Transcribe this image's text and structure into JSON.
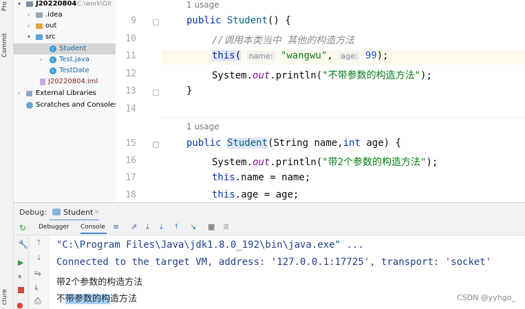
{
  "side_strip": {
    "project_label": "Pro",
    "commit_label": "Commit",
    "structure_label": "cture"
  },
  "tree": {
    "root": {
      "name": "J20220804",
      "path": "C:\\work\\Git"
    },
    "items": [
      {
        "label": ".idea"
      },
      {
        "label": "out"
      },
      {
        "label": "src"
      },
      {
        "label": "Student"
      },
      {
        "label": "Test.java"
      },
      {
        "label": "TestDate"
      },
      {
        "label": "J20220804.iml"
      },
      {
        "label": "External Libraries"
      },
      {
        "label": "Scratches and Consoles"
      }
    ]
  },
  "editor": {
    "line_numbers": [
      "9",
      "10",
      "11",
      "12",
      "13",
      "14",
      "15",
      "16",
      "17",
      "18"
    ],
    "usage1": "1 usage",
    "usage2": "1 usage",
    "l9_kw": "public ",
    "l9_fn": "Student",
    "l9_rest": "() {",
    "l10_comment": "//调用本类当中 其他的构造方法",
    "l11_this": "this",
    "l11_paren": "(",
    "l11_hint_name": "name:",
    "l11_str": "\"wangwu\"",
    "l11_comma": ", ",
    "l11_hint_age": "age:",
    "l11_num": "99",
    "l11_end": ");",
    "l12_a": "System.",
    "l12_field": "out",
    "l12_b": ".println(",
    "l12_str": "\"不带参数的构造方法\"",
    "l12_end": ");",
    "l13": "}",
    "l15_kw": "public ",
    "l15_fn": "Student",
    "l15_a": "(String name,",
    "l15_kw2": "int",
    "l15_b": " age) {",
    "l16_a": "System.",
    "l16_field": "out",
    "l16_b": ".println(",
    "l16_str": "\"带2个参数的构造方法\"",
    "l16_end": ");",
    "l17_kw": "this",
    "l17_rest": ".name = name;",
    "l18_kw": "this",
    "l18_rest": ".age = age;"
  },
  "debug": {
    "label": "Debug:",
    "tab": "Student",
    "tabs": [
      "Debugger",
      "Console"
    ],
    "console_lines": [
      "\"C:\\Program Files\\Java\\jdk1.8.0_192\\bin\\java.exe\" ...",
      "Connected to the target VM, address: '127.0.0.1:17725', transport: 'socket'",
      "带2个参数的构造方法"
    ],
    "last_line_pre": "不",
    "last_line_sel": "带参数的构",
    "last_line_post": "造方法"
  },
  "watermark": "CSDN @yyhgo_",
  "colors": {
    "keyword": "#0033b3",
    "string": "#067d17",
    "number": "#1750eb",
    "selection": "#a6d2ff"
  }
}
